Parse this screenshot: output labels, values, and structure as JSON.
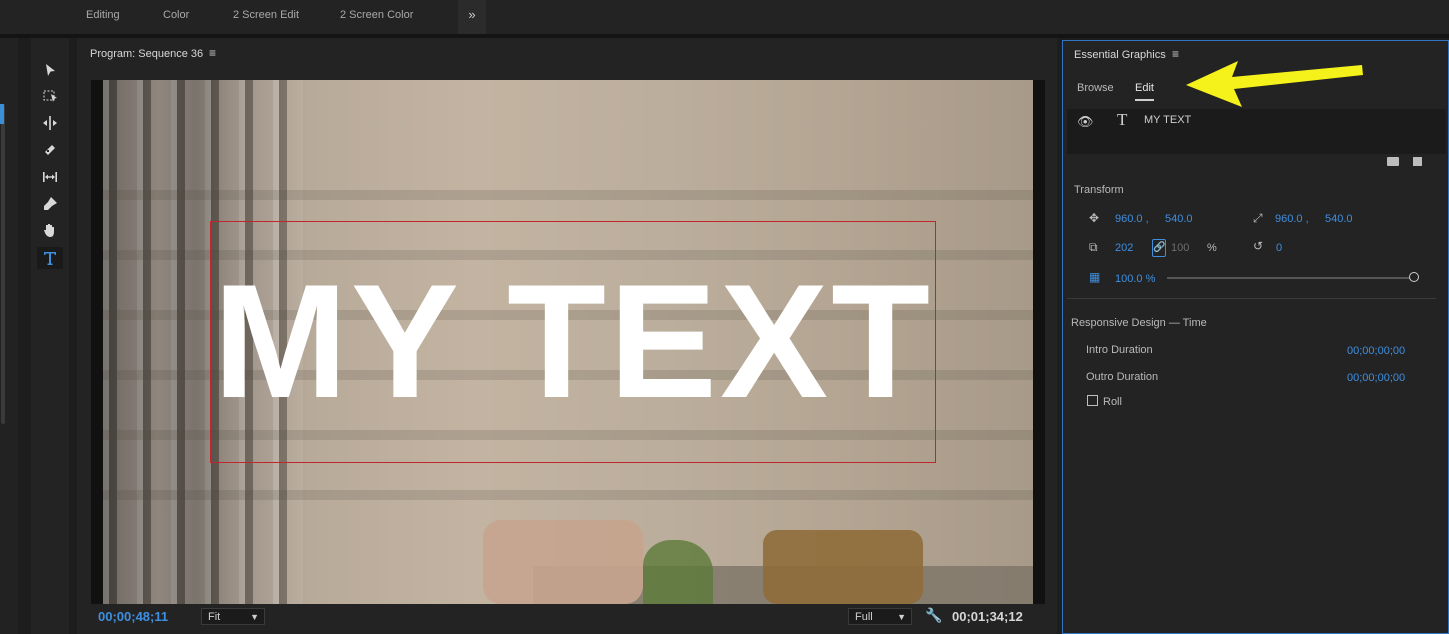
{
  "workspace_tabs": [
    "Editing",
    "Color",
    "2 Screen Edit",
    "2 Screen Color"
  ],
  "workspace_more": "»",
  "tools": [
    {
      "icon": "selection-tool-icon"
    },
    {
      "icon": "track-select-tool-icon"
    },
    {
      "icon": "ripple-edit-tool-icon"
    },
    {
      "icon": "razor-tool-icon"
    },
    {
      "icon": "slip-tool-icon"
    },
    {
      "icon": "pen-tool-icon"
    },
    {
      "icon": "hand-tool-icon"
    },
    {
      "icon": "type-tool-icon",
      "active": true
    }
  ],
  "program": {
    "title": "Program: Sequence 36",
    "menu_glyph": "≡",
    "overlay_text": "MY TEXT",
    "timecode_current": "00;00;48;11",
    "zoom": "Fit",
    "resolution": "Full",
    "timecode_duration": "00;01;34;12"
  },
  "essential_graphics": {
    "title": "Essential Graphics",
    "menu_glyph": "≡",
    "tabs": [
      "Browse",
      "Edit"
    ],
    "active_tab": "Edit",
    "layer": {
      "name": "MY TEXT"
    },
    "transform": {
      "label": "Transform",
      "position_x": "960.0 ,",
      "position_y": "540.0",
      "anchor_x": "960.0 ,",
      "anchor_y": "540.0",
      "scale": "202",
      "scale_height": "100",
      "scale_unit": "%",
      "rotation": "0",
      "opacity": "100.0 %",
      "opacity_value": 1.0
    },
    "responsive": {
      "label": "Responsive Design — Time",
      "intro_label": "Intro Duration",
      "intro_value": "00;00;00;00",
      "outro_label": "Outro Duration",
      "outro_value": "00;00;00;00",
      "roll_label": "Roll"
    }
  },
  "colors": {
    "accent": "#3f8fe0",
    "annotation_arrow": "#f5f11a",
    "text_box": "#c0272d"
  }
}
